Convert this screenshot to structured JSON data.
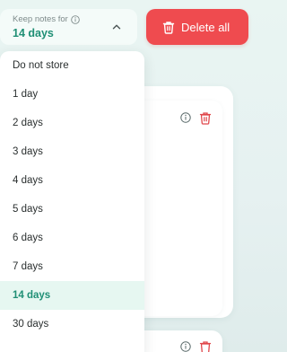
{
  "keep_notes": {
    "label": "Keep notes for",
    "value": "14 days",
    "icons": {
      "info": "info-icon",
      "toggle": "chevron-up-icon"
    }
  },
  "delete_all": {
    "label": "Delete all",
    "icon": "trash-icon"
  },
  "dropdown": {
    "options": [
      "Do not store",
      "1 day",
      "2 days",
      "3 days",
      "4 days",
      "5 days",
      "6 days",
      "7 days",
      "14 days",
      "30 days"
    ],
    "selected": "14 days"
  },
  "colors": {
    "accent": "#1f8f75",
    "danger": "#ef4b4f",
    "selected_bg": "#e6f7f1",
    "background": "#e9f5f2"
  }
}
